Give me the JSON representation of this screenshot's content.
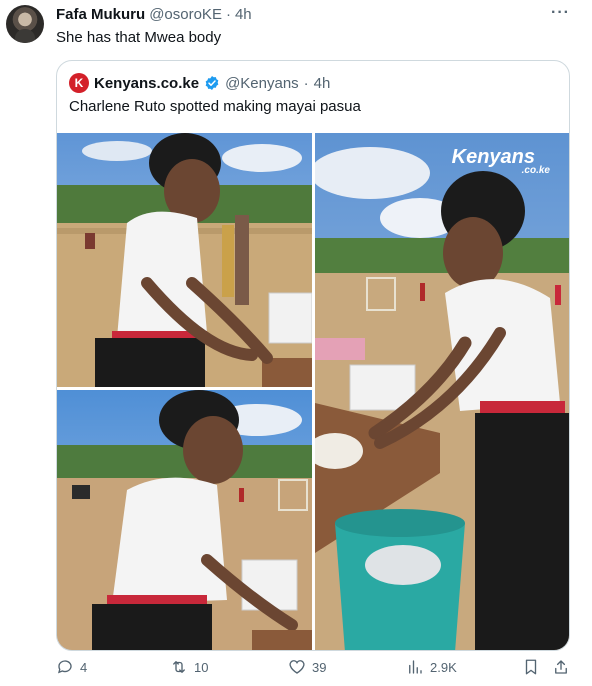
{
  "tweet": {
    "author_name": "Fafa Mukuru",
    "author_handle": "@osoroKE",
    "separator": "·",
    "time": "4h",
    "text": "She has that Mwea body",
    "more_icon": "more-dots-icon"
  },
  "quote": {
    "logo_letter": "K",
    "author_name": "Kenyans.co.ke",
    "author_handle": "@Kenyans",
    "separator": "·",
    "time": "4h",
    "text": "Charlene Ruto spotted making mayai pasua",
    "verified_color": "#1d9bf0",
    "watermark_main": "Kenyans",
    "watermark_sub": ".co.ke"
  },
  "actions": {
    "replies": "4",
    "reposts": "10",
    "likes": "39",
    "views": "2.9K"
  },
  "colors": {
    "text_primary": "#0f1419",
    "text_secondary": "#536471",
    "border": "#cfd9de",
    "brand_red": "#d32029"
  }
}
